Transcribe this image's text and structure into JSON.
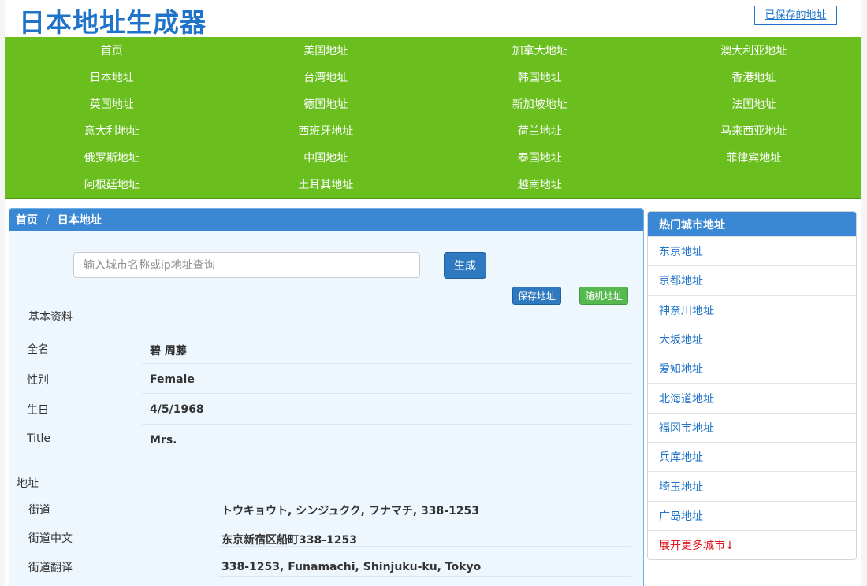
{
  "header": {
    "title": "日本地址生成器",
    "saved_button": "已保存的地址"
  },
  "nav": {
    "items": [
      "首页",
      "美国地址",
      "加拿大地址",
      "澳大利亚地址",
      "日本地址",
      "台湾地址",
      "韩国地址",
      "香港地址",
      "英国地址",
      "德国地址",
      "新加坡地址",
      "法国地址",
      "意大利地址",
      "西班牙地址",
      "荷兰地址",
      "马来西亚地址",
      "俄罗斯地址",
      "中国地址",
      "泰国地址",
      "菲律宾地址",
      "阿根廷地址",
      "土耳其地址",
      "越南地址"
    ]
  },
  "breadcrumb": {
    "home": "首页",
    "separator": "/",
    "current": "日本地址"
  },
  "search": {
    "placeholder": "输入城市名称或ip地址查询",
    "value": "",
    "generate_button": "生成",
    "save_button": "保存地址",
    "random_button": "随机地址"
  },
  "basic": {
    "title": "基本资料",
    "rows": [
      {
        "label": "全名",
        "value": "碧 周藤"
      },
      {
        "label": "性别",
        "value": "Female"
      },
      {
        "label": "生日",
        "value": "4/5/1968"
      },
      {
        "label": "Title",
        "value": "Mrs."
      }
    ]
  },
  "address": {
    "title": "地址",
    "rows": [
      {
        "label": "街道",
        "value": "トウキョウト, シンジュクク, フナマチ, 338-1253"
      },
      {
        "label": "街道中文",
        "value": "东京新宿区船町338-1253"
      },
      {
        "label": "街道翻译",
        "value": "338-1253, Funamachi, Shinjuku-ku, Tokyo"
      }
    ]
  },
  "sidebar": {
    "title": "热门城市地址",
    "items": [
      "东京地址",
      "京都地址",
      "神奈川地址",
      "大坂地址",
      "爱知地址",
      "北海道地址",
      "福冈市地址",
      "兵库地址",
      "埼玉地址",
      "广岛地址"
    ],
    "more": "展开更多城市↓"
  },
  "colors": {
    "brand_blue": "#1f73c9",
    "nav_green": "#6abf1e",
    "panel_header_blue": "#3a87d4",
    "random_green": "#55b94f",
    "more_red": "#e0161c"
  }
}
